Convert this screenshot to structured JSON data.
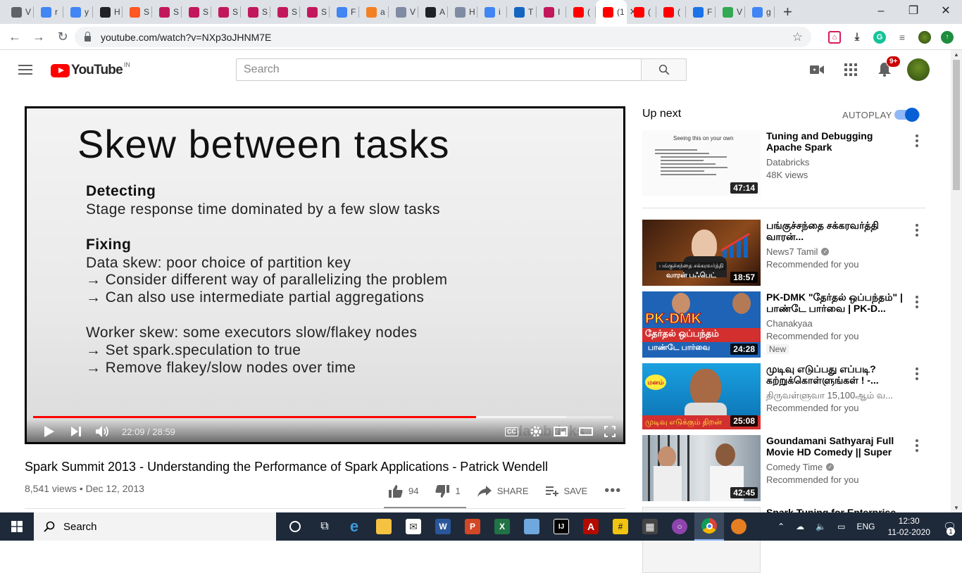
{
  "browser": {
    "tabs": [
      {
        "icon": "globe-icon",
        "color": "#5f6368",
        "char": "V"
      },
      {
        "icon": "google-icon",
        "color": "#4285f4",
        "char": "r"
      },
      {
        "icon": "google-icon",
        "color": "#4285f4",
        "char": "y"
      },
      {
        "icon": "db-icon",
        "color": "#202124",
        "char": "H"
      },
      {
        "icon": "c-icon",
        "color": "#ff5722",
        "char": "S"
      },
      {
        "icon": "m-icon",
        "color": "#c2185b",
        "char": "S"
      },
      {
        "icon": "m-icon",
        "color": "#c2185b",
        "char": "S"
      },
      {
        "icon": "m-icon",
        "color": "#c2185b",
        "char": "S"
      },
      {
        "icon": "m-icon",
        "color": "#c2185b",
        "char": "S"
      },
      {
        "icon": "m-icon",
        "color": "#c2185b",
        "char": "S"
      },
      {
        "icon": "m-icon",
        "color": "#c2185b",
        "char": "S"
      },
      {
        "icon": "google-icon",
        "color": "#4285f4",
        "char": "F"
      },
      {
        "icon": "stack-icon",
        "color": "#f48024",
        "char": "a"
      },
      {
        "icon": "hex-icon",
        "color": "#7e8ba3",
        "char": "V"
      },
      {
        "icon": "sl-icon",
        "color": "#202124",
        "char": "A"
      },
      {
        "icon": "hex-icon",
        "color": "#7e8ba3",
        "char": "H"
      },
      {
        "icon": "google-icon",
        "color": "#4285f4",
        "char": "i"
      },
      {
        "icon": "chart-icon",
        "color": "#1565c0",
        "char": "T"
      },
      {
        "icon": "m-icon",
        "color": "#c2185b",
        "char": "I"
      },
      {
        "icon": "youtube-icon",
        "color": "#ff0000",
        "char": "("
      },
      {
        "icon": "youtube-icon",
        "color": "#ff0000",
        "char": "(1"
      },
      {
        "icon": "youtube-icon",
        "color": "#ff0000",
        "char": "("
      },
      {
        "icon": "youtube-icon",
        "color": "#ff0000",
        "char": "("
      },
      {
        "icon": "moon-icon",
        "color": "#1a73e8",
        "char": "F"
      },
      {
        "icon": "maps-icon",
        "color": "#34a853",
        "char": "V"
      },
      {
        "icon": "google-icon",
        "color": "#4285f4",
        "char": "g"
      }
    ],
    "url": "youtube.com/watch?v=NXp3oJHNM7E"
  },
  "masthead": {
    "logo_text": "YouTube",
    "country": "IN",
    "search_placeholder": "Search",
    "notif_count": "9+"
  },
  "player": {
    "slide": {
      "title": "Skew between tasks",
      "lines": [
        {
          "text": "Detecting",
          "bold": true
        },
        {
          "text": "Stage response time dominated by a few slow tasks",
          "bold": false
        },
        {
          "text": "Fixing",
          "bold": true
        },
        {
          "text": "Data skew: poor choice of partition key",
          "bold": false
        },
        {
          "text": "→ Consider different way of parallelizing the problem",
          "bold": false
        },
        {
          "text": "→ Can also use intermediate partial aggregations",
          "bold": false
        },
        {
          "text": "Worker skew: some executors slow/flakey nodes",
          "bold": false
        },
        {
          "text": "→ Set spark.speculation to true",
          "bold": false
        },
        {
          "text": "→ Remove flakey/slow nodes over time",
          "bold": false
        }
      ],
      "watermark": "databricks"
    },
    "time": "22:09 / 28:59",
    "progress_played": 0.764,
    "progress_loaded": 0.92
  },
  "video": {
    "title": "Spark Summit 2013 - Understanding the Performance of Spark Applications - Patrick Wendell",
    "views": "8,541 views",
    "date": "Dec 12, 2013",
    "likes": "94",
    "dislikes": "1",
    "share": "SHARE",
    "save": "SAVE"
  },
  "sidebar": {
    "up_next": "Up next",
    "autoplay": "AUTOPLAY",
    "videos": [
      {
        "title": "Tuning and Debugging Apache Spark",
        "channel": "Databricks",
        "meta": "48K views",
        "duration": "47:14",
        "verified": false,
        "new": "",
        "thumb": "slide"
      },
      {
        "title": "பங்குச்சந்தை சக்கரவர்த்தி வாரன்...",
        "channel": "News7 Tamil",
        "meta": "Recommended for you",
        "duration": "18:57",
        "verified": true,
        "new": "",
        "thumb": "stocks"
      },
      {
        "title": "PK-DMK \"தேர்தல் ஒப்பந்தம்\" | பாண்டே பார்வை | PK-D...",
        "channel": "Chanakyaa",
        "meta": "Recommended for you",
        "duration": "24:28",
        "verified": false,
        "new": "New",
        "thumb": "pkdmk"
      },
      {
        "title": "முடிவு எடுப்பது எப்படி? கற்றுக்கொள்ளுங்கள் ! -...",
        "channel": "திருவள்ளுவா 15,100ஆம் வ...",
        "meta": "Recommended for you",
        "duration": "25:08",
        "verified": false,
        "new": "",
        "thumb": "manam"
      },
      {
        "title": "Goundamani Sathyaraj Full Movie HD Comedy || Super Hit...",
        "channel": "Comedy Time",
        "meta": "Recommended for you",
        "duration": "42:45",
        "verified": true,
        "new": "",
        "thumb": "movie"
      },
      {
        "title": "Spark Tuning for Enterprise",
        "channel": "",
        "meta": "",
        "duration": "",
        "verified": false,
        "new": "",
        "thumb": "slide2"
      }
    ],
    "thumb_texts": {
      "slide_head": "Seeing this on your own",
      "stocks_caption": "பங்குச்சந்தை சக்கரவர்த்தி",
      "stocks_name": "வாரன் பஃபெட்",
      "pk_logo": "PK-DMK",
      "pk_line1": "தேர்தல் ஒப்பந்தம்",
      "pk_line2": "பாண்டே பார்வை",
      "manam_badge": "மனம்",
      "manam_caption": "முடிவு எடுக்கும் திறன்"
    }
  },
  "taskbar": {
    "search_label": "Search",
    "lang": "ENG",
    "time": "12:30",
    "date": "11-02-2020",
    "notifications": "1"
  }
}
